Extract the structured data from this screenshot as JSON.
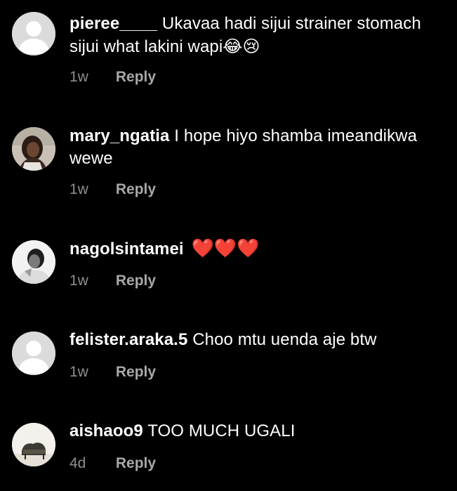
{
  "comments": [
    {
      "username": "pieree____",
      "text": "Ukavaa hadi sijui strainer stomach sijui what lakini wapi",
      "emoji": "😂😢",
      "time": "1w",
      "reply": "Reply",
      "avatar": "default-avatar-icon"
    },
    {
      "username": "mary_ngatia",
      "text": "I hope hiyo shamba imeandikwa wewe",
      "emoji": "",
      "time": "1w",
      "reply": "Reply",
      "avatar": "user-photo"
    },
    {
      "username": "nagolsintamei",
      "text": "",
      "emoji": "❤️❤️❤️",
      "time": "1w",
      "reply": "Reply",
      "avatar": "user-photo"
    },
    {
      "username": "felister.araka.5",
      "text": "Choo mtu uenda aje btw",
      "emoji": "",
      "time": "1w",
      "reply": "Reply",
      "avatar": "default-avatar-icon"
    },
    {
      "username": "aishaoo9",
      "text": "TOO MUCH UGALI",
      "emoji": "",
      "time": "4d",
      "reply": "Reply",
      "avatar": "user-photo"
    }
  ],
  "colors": {
    "background": "#000000",
    "primary_text": "#ffffff",
    "secondary_text": "#8e8e8e",
    "heart": "#ed2b3c",
    "default_avatar_bg": "#dbdbdb"
  }
}
